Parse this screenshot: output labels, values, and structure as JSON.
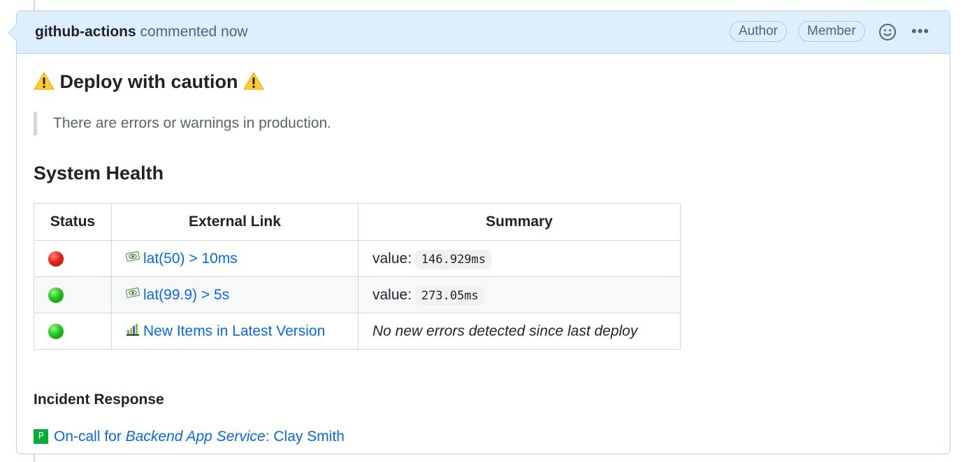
{
  "comment": {
    "author": "github-actions",
    "action_text": "commented now",
    "badges": [
      "Author",
      "Member"
    ],
    "emoji_icon": "smiley-icon",
    "more_icon": "kebab-horizontal-icon",
    "more_label": "•••"
  },
  "deploy": {
    "title": "Deploy with caution",
    "warning_icon": "warning-sign-icon",
    "notice": "There are errors or warnings in production."
  },
  "health": {
    "title": "System Health",
    "columns": [
      "Status",
      "External Link",
      "Summary"
    ],
    "rows": [
      {
        "status": "red",
        "link_icon": "money-eye-icon",
        "link_text": "lat(50) > 10ms",
        "summary_prefix": "value:",
        "summary_code": "146.929ms"
      },
      {
        "status": "green",
        "link_icon": "money-eye-icon",
        "link_text": "lat(99.9) > 5s",
        "summary_prefix": "value:",
        "summary_code": "273.05ms"
      },
      {
        "status": "green",
        "link_icon": "rollbar-icon",
        "link_text": "New Items in Latest Version",
        "summary_text": "No new errors detected since last deploy"
      }
    ]
  },
  "incident": {
    "title": "Incident Response",
    "pd_icon_label": "P",
    "oncall_prefix": "On-call for ",
    "oncall_service": "Backend App Service",
    "oncall_suffix": ": Clay Smith"
  },
  "colors": {
    "header_bg": "#ddeefc",
    "link": "#0969da",
    "status_red": "#e8231b",
    "status_green": "#22c21b",
    "pagerduty_green": "#06ac38"
  }
}
